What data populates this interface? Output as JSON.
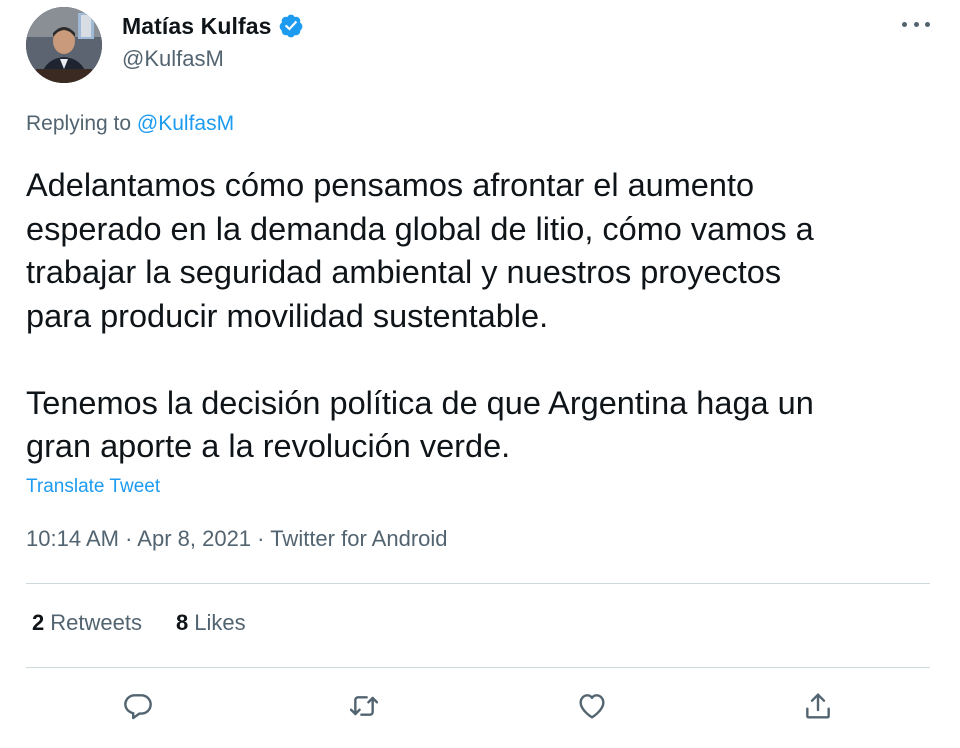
{
  "author": {
    "display_name": "Matías Kulfas",
    "handle": "@KulfasM",
    "verified": true
  },
  "reply": {
    "prefix": "Replying to ",
    "mention": "@KulfasM"
  },
  "tweet": {
    "text": "Adelantamos cómo pensamos afrontar el aumento\nesperado en la demanda global de litio, cómo vamos a\ntrabajar la seguridad ambiental y nuestros proyectos\npara producir movilidad sustentable.\n\nTenemos la decisión política de que Argentina haga un\ngran aporte a la revolución verde.",
    "translate_label": "Translate Tweet"
  },
  "meta": {
    "time": "10:14 AM",
    "separator": " · ",
    "date": "Apr 8, 2021",
    "source": "Twitter for Android"
  },
  "stats": {
    "retweets_count": "2",
    "retweets_label": "Retweets",
    "likes_count": "8",
    "likes_label": "Likes"
  },
  "icons": {
    "verified": "verified-badge-icon",
    "more": "more-options-icon",
    "reply": "reply-icon",
    "retweet": "retweet-icon",
    "like": "heart-icon",
    "share": "share-icon"
  },
  "colors": {
    "accent": "#1d9bf0",
    "secondary_text": "#536471",
    "primary_text": "#0f1419",
    "divider": "#cfd9de"
  }
}
